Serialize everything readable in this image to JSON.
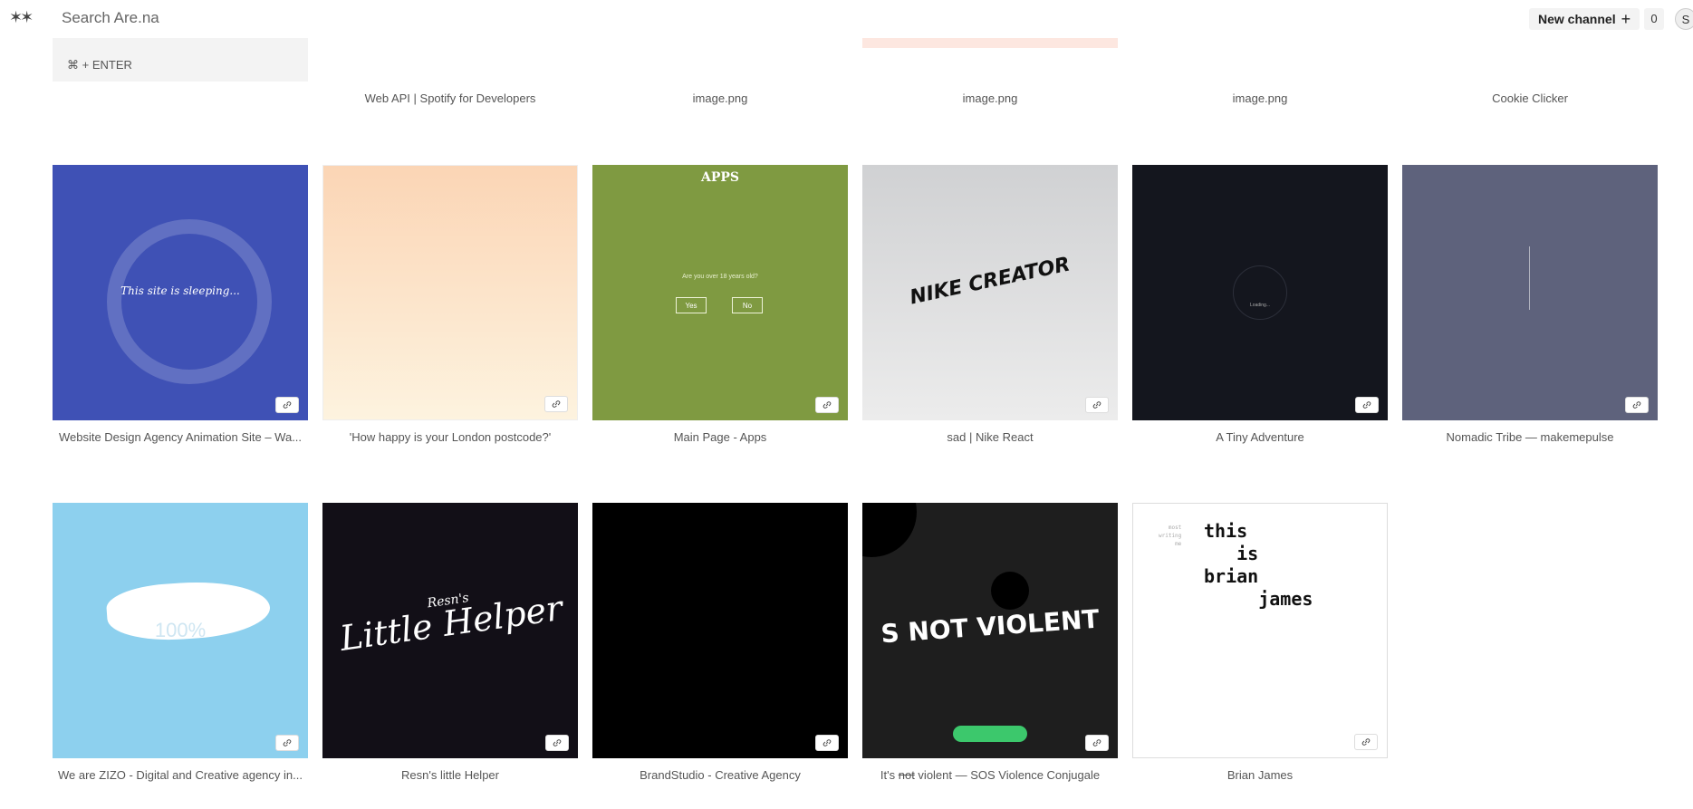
{
  "topbar": {
    "logo": "✶✶",
    "search_placeholder": "Search Are.na",
    "new_channel_label": "New channel",
    "new_channel_icon": "+",
    "notification_count": "0",
    "avatar_initial": "S"
  },
  "add_block": {
    "shortcut": "⌘ + ENTER"
  },
  "blocks_row0": [
    {
      "title": "Web API | Spotify for Developers"
    },
    {
      "title": "image.png"
    },
    {
      "title": "image.png"
    },
    {
      "title": "image.png"
    },
    {
      "title": "Cookie Clicker"
    }
  ],
  "blocks_row1": [
    {
      "title": "Website Design Agency Animation Site – Wa...",
      "art_text": "This site is sleeping..."
    },
    {
      "title": "'How happy is your London postcode?'"
    },
    {
      "title": "Main Page - Apps",
      "art_title": "APPS",
      "art_question": "Are you over 18 years old?",
      "art_yes": "Yes",
      "art_no": "No"
    },
    {
      "title": "sad | Nike React",
      "art_text": "NIKE CREATOR"
    },
    {
      "title": "A Tiny Adventure",
      "art_text": "Loading..."
    },
    {
      "title": "Nomadic Tribe — makemepulse"
    }
  ],
  "blocks_row2": [
    {
      "title": "We are ZIZO - Digital and Creative agency in...",
      "art_text": "100%"
    },
    {
      "title": "Resn's little Helper",
      "art_text_a": "Resn's",
      "art_text_b": "Little Helper"
    },
    {
      "title": "BrandStudio - Creative Agency"
    },
    {
      "title_prefix": "It's ",
      "title_strike": "not",
      "title_suffix": " violent — SOS Violence Conjugale",
      "art_text": "S NOT VIOLENT",
      "art_strike": "NOT"
    },
    {
      "title": "Brian James",
      "art_side": "most\nwriting\nme",
      "art_text": "this\n   is\nbrian\n     james"
    }
  ],
  "colors": {
    "accent_blue": "#3f51b5",
    "apps_green": "#7f9a41",
    "sos_red": "#e24848"
  }
}
